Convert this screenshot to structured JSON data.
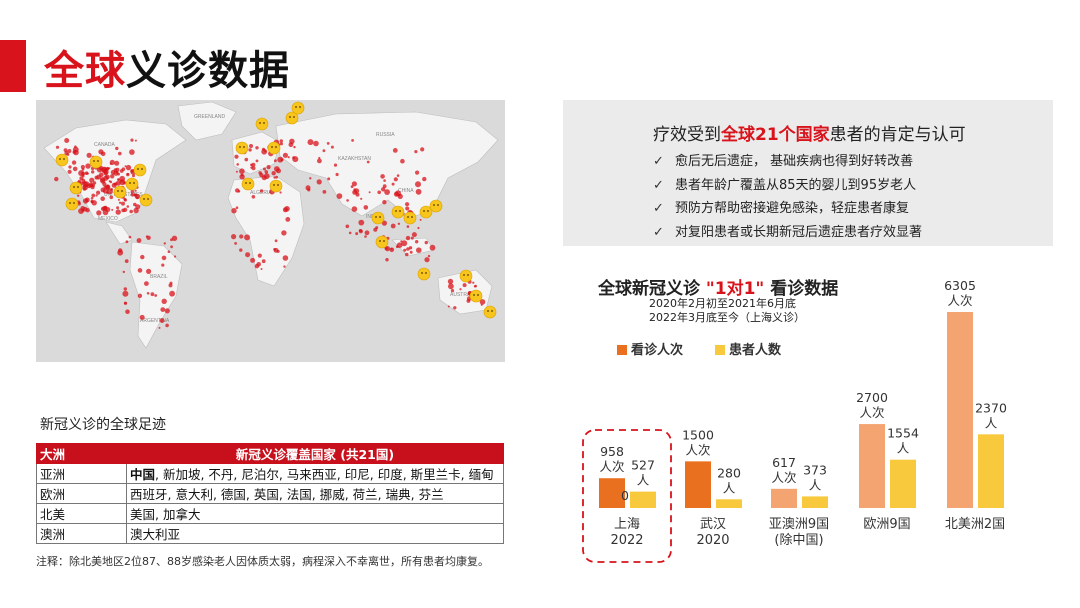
{
  "header": {
    "title_red": "全球",
    "title_rest": "义诊数据"
  },
  "colors": {
    "accent_red": "#d8131b",
    "visits_orange": "#e8701f",
    "visits_light_orange": "#f4a470",
    "patients_yellow": "#f9c93d",
    "map_dot": "#d8131b",
    "map_land": "#f4f4f4",
    "map_water": "#dadada"
  },
  "map": {
    "icon": "world-map-with-dots",
    "labels": [
      "CANADA",
      "GREENLAND",
      "UNITED STATES",
      "RUSSIA",
      "CHINA",
      "INDIA",
      "AUSTRALIA",
      "BRAZIL",
      "ARGENTINA",
      "ALGERIA",
      "MEXICO",
      "KAZAKHSTAN"
    ]
  },
  "callout": {
    "title_pre": "疗效受到",
    "title_red": "全球21个国家",
    "title_post": "患者的肯定与认可",
    "items": [
      {
        "check": "✓",
        "text": "愈后无后遗症， 基础疾病也得到好转改善"
      },
      {
        "check": "✓",
        "text": "患者年龄广覆盖从85天的婴儿到95岁老人"
      },
      {
        "check": "✓",
        "text": "预防方帮助密接避免感染，轻症患者康复"
      },
      {
        "check": "✓",
        "text": "对复阳患者或长期新冠后遗症患者疗效显著"
      }
    ]
  },
  "footprint": {
    "title": "新冠义诊的全球足迹",
    "headers": [
      "大洲",
      "新冠义诊覆盖国家 (共21国)"
    ],
    "rows": [
      {
        "continent": "亚洲",
        "bold": "中国",
        "countries": ", 新加坡, 不丹, 尼泊尔, 马来西亚, 印尼, 印度, 斯里兰卡, 缅甸"
      },
      {
        "continent": "欧洲",
        "bold": "",
        "countries": "西班牙, 意大利, 德国, 英国, 法国, 挪威, 荷兰, 瑞典, 芬兰"
      },
      {
        "continent": "北美",
        "bold": "",
        "countries": "美国, 加拿大"
      },
      {
        "continent": "澳洲",
        "bold": "",
        "countries": "澳大利亚"
      }
    ],
    "note": "注释：除北美地区2位87、88岁感染老人因体质太弱，病程深入不幸离世，所有患者均康复。"
  },
  "chart_data": {
    "type": "bar",
    "title_pre": "全球新冠义诊",
    "title_red": "\"1对1\"",
    "title_post": "看诊数据",
    "subtitle_lines": [
      "2020年2月初至2021年6月底",
      "2022年3月底至今（上海义诊）"
    ],
    "categories": [
      [
        "上海",
        "2022"
      ],
      [
        "武汉",
        "2020"
      ],
      [
        "亚澳洲9国",
        "(除中国)"
      ],
      [
        "欧洲9国"
      ],
      [
        "北美洲2国"
      ]
    ],
    "series": [
      {
        "name": "看诊人次",
        "unit": "人次",
        "values": [
          958,
          1500,
          617,
          2700,
          6305
        ],
        "colors": [
          "#e8701f",
          "#e8701f",
          "#f4a470",
          "#f4a470",
          "#f4a470"
        ]
      },
      {
        "name": "患者人数",
        "unit": "人",
        "values": [
          527,
          280,
          373,
          1554,
          2370
        ],
        "colors": [
          "#f9c93d",
          "#f9c93d",
          "#f9c93d",
          "#f9c93d",
          "#f9c93d"
        ]
      }
    ],
    "stray_label": "0",
    "highlight_category": 0,
    "ylim": [
      0,
      6305
    ],
    "legend_position": "top-left"
  }
}
